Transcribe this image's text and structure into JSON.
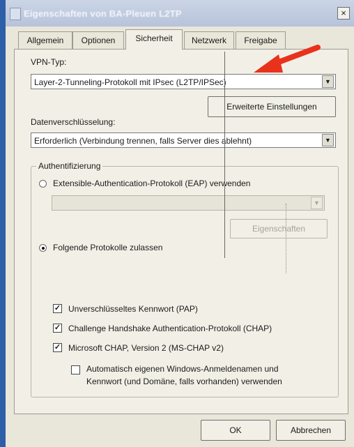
{
  "window": {
    "title": "Eigenschaften von BA-Pleuen L2TP",
    "close_label": "×"
  },
  "tabs": [
    {
      "label": "Allgemein"
    },
    {
      "label": "Optionen"
    },
    {
      "label": "Sicherheit"
    },
    {
      "label": "Netzwerk"
    },
    {
      "label": "Freigabe"
    }
  ],
  "vpn": {
    "label": "VPN-Typ:",
    "value": "Layer-2-Tunneling-Protokoll mit IPsec (L2TP/IPSec)",
    "advanced_button": "Erweiterte Einstellungen"
  },
  "encryption": {
    "label": "Datenverschlüsselung:",
    "value": "Erforderlich (Verbindung trennen, falls Server dies ablehnt)"
  },
  "auth": {
    "group_label": "Authentifizierung",
    "eap_label": "Extensible-Authentication-Protokoll (EAP) verwenden",
    "eap_properties_button": "Eigenschaften",
    "allow_label": "Folgende Protokolle zulassen",
    "selected": "allow",
    "protocols": [
      {
        "label": "Unverschlüsseltes Kennwort (PAP)",
        "checked": true
      },
      {
        "label": "Challenge Handshake Authentication-Protokoll (CHAP)",
        "checked": true
      },
      {
        "label": "Microsoft CHAP, Version 2 (MS-CHAP v2)",
        "checked": true
      }
    ],
    "auto_logon_line1": "Automatisch eigenen Windows-Anmeldenamen und",
    "auto_logon_line2": "Kennwort (und Domäne, falls vorhanden) verwenden",
    "auto_logon_checked": false
  },
  "footer": {
    "ok_label": "OK",
    "cancel_label": "Abbrechen"
  },
  "annotation": {
    "arrow_color": "#e8321c"
  }
}
